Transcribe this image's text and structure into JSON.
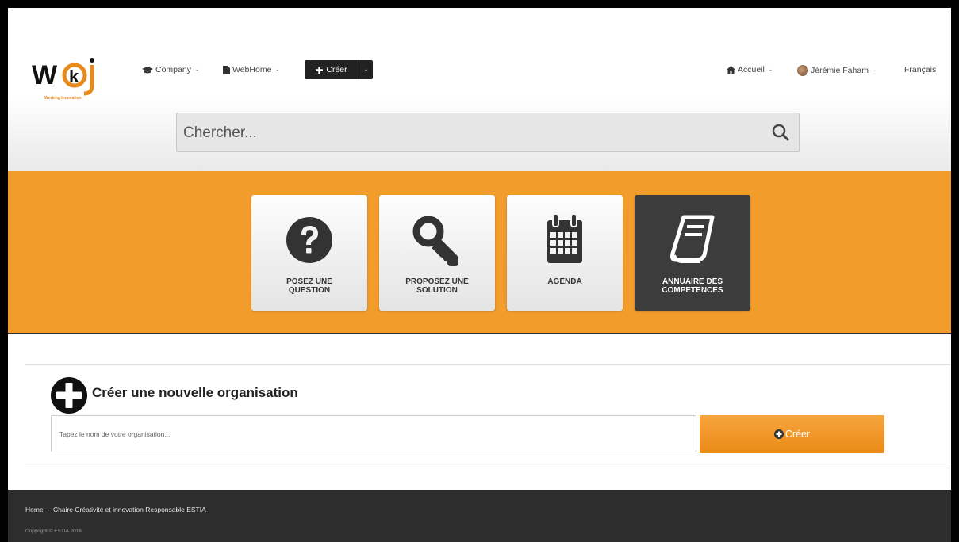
{
  "header": {
    "logo_text": "Wkj",
    "logo_subtitle": "Working Innovation",
    "nav": {
      "company": "Company",
      "webhome": "WebHome",
      "create_button": "Créer"
    },
    "right_nav": {
      "home": "Accueil",
      "user": "Jérémie Faham",
      "language": "Français"
    }
  },
  "search": {
    "placeholder": "Chercher..."
  },
  "tiles": [
    {
      "label": "POSEZ UNE QUESTION",
      "icon": "question-circle-icon"
    },
    {
      "label": "PROPOSEZ UNE SOLUTION",
      "icon": "key-icon"
    },
    {
      "label": "AGENDA",
      "icon": "calendar-icon"
    },
    {
      "label": "ANNUAIRE DES COMPETENCES",
      "icon": "book-icon"
    }
  ],
  "organisation": {
    "title": "Créer une nouvelle organisation",
    "input_placeholder": "Tapez le nom de votre organisation...",
    "button_label": "Créer"
  },
  "footer": {
    "breadcrumb_home": "Home",
    "breadcrumb_separator": "-",
    "breadcrumb_current": "Chaire Créativité et innovation Responsable ESTIA",
    "copyright": "Copyright © ESTIA 2016"
  },
  "colors": {
    "accent_orange": "#f29c2b",
    "dark": "#3c3c3c",
    "footer": "#2d2d2d"
  }
}
